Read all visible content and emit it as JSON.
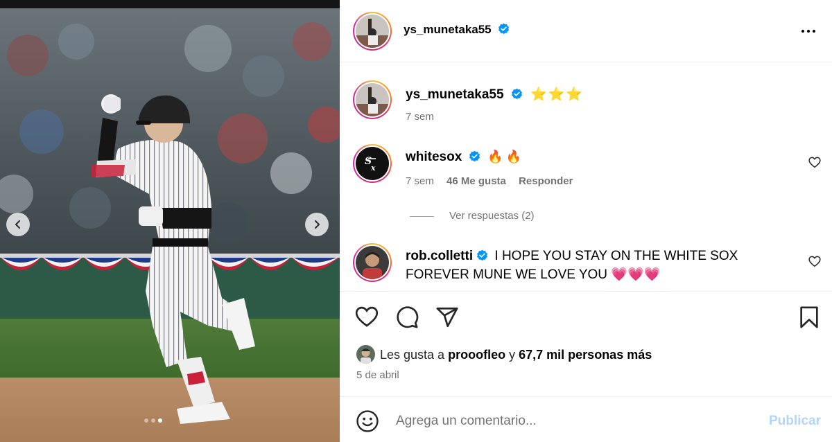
{
  "post": {
    "author": "ys_munetaka55",
    "slide_count": 3,
    "active_slide": 3
  },
  "caption": {
    "username": "ys_munetaka55",
    "text": "⭐⭐⭐",
    "time": "7 sem"
  },
  "comments": [
    {
      "username": "whitesox",
      "text": "🔥🔥",
      "time": "7 sem",
      "likes": "46 Me gusta",
      "reply_label": "Responder",
      "view_replies": "Ver respuestas (2)"
    },
    {
      "username": "rob.colletti",
      "text": "I HOPE YOU STAY ON THE WHITE SOX FOREVER MUNE WE LOVE YOU 💗💗💗"
    }
  ],
  "likes": {
    "prefix": "Les gusta a",
    "user": "prooofleo",
    "connector": "y",
    "others": "67,7 mil personas más"
  },
  "date": "5 de abril",
  "comment_box": {
    "placeholder": "Agrega un comentario...",
    "post_label": "Publicar"
  },
  "colors": {
    "verified": "#0095f6",
    "post_button_disabled": "#b3d5f9"
  },
  "icons": [
    "chevron-left-icon",
    "chevron-right-icon",
    "more-icon",
    "heart-icon",
    "comment-icon",
    "share-icon",
    "bookmark-icon",
    "emoji-icon",
    "verified-icon"
  ]
}
